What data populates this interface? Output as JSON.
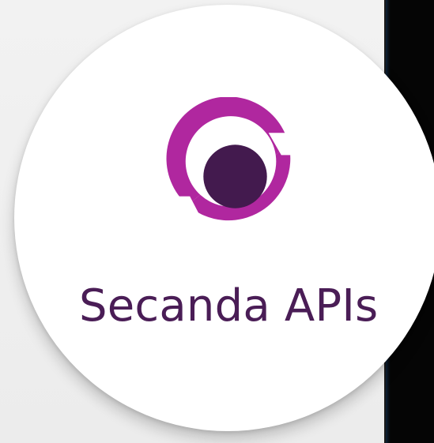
{
  "app": {
    "brand_name": "Secanda APIs"
  },
  "icons": {
    "logo": "secanda-logo-icon"
  },
  "colors": {
    "background": "#f0f0f0",
    "badge_background": "#ffffff",
    "logo_ring": "#b0279f",
    "logo_core": "#431a4e",
    "brand_text": "#4a1d56",
    "dark_panel": "#050505"
  }
}
